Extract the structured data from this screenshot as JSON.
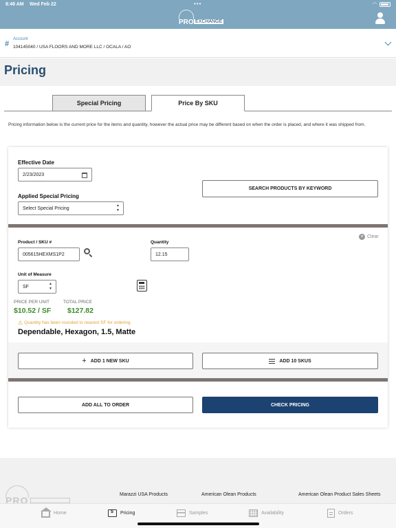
{
  "status_bar": {
    "time": "8:48 AM",
    "date": "Wed Feb 22",
    "dots": "•••"
  },
  "header": {
    "logo_pro": "PRO",
    "logo_exchange": "EXCHANGE"
  },
  "account": {
    "label": "Account",
    "value": "104145040 / USA FLOORS AND MORE LLC / OCALA / AO"
  },
  "page": {
    "title": "Pricing"
  },
  "tabs": [
    {
      "label": "Special Pricing",
      "active": false
    },
    {
      "label": "Price By SKU",
      "active": true
    }
  ],
  "info_text": "Pricing information below is the current price for the items and quantity, however the actual price may be different based on when the order is placed, and where it was shipped from.",
  "form": {
    "effective_date_label": "Effective Date",
    "effective_date_value": "2/23/2023",
    "special_pricing_label": "Applied Special Pricing",
    "special_pricing_value": "Select Special Pricing",
    "search_keyword_button": "SEARCH PRODUCTS BY KEYWORD"
  },
  "sku_entry": {
    "clear_label": "Clear",
    "product_label": "Product / SKU #",
    "product_value": "005615HEXMS1P2",
    "quantity_label": "Quantity",
    "quantity_value": "12.15",
    "uom_label": "Unit of Measure",
    "uom_value": "SF",
    "price_per_unit_label": "PRICE PER UNIT",
    "price_per_unit_value": "$10.52 / SF",
    "total_price_label": "TOTAL PRICE",
    "total_price_value": "$127.82",
    "warning": "Quantity has been rounded to nearest SF for ordering.",
    "product_name": "Dependable, Hexagon, 1.5, Matte"
  },
  "actions": {
    "add_new_sku": "ADD 1 NEW SKU",
    "add_ten_skus": "ADD 10 SKUS",
    "add_all_to_order": "ADD ALL TO ORDER",
    "check_pricing": "CHECK PRICING"
  },
  "footer": {
    "links": [
      "Marazzi USA Products",
      "American Olean Products",
      "American Olean Product Sales Sheets"
    ]
  },
  "tabbar": [
    {
      "label": "Home",
      "icon": "home-icon"
    },
    {
      "label": "Pricing",
      "icon": "pricing-icon",
      "active": true
    },
    {
      "label": "Samples",
      "icon": "samples-icon"
    },
    {
      "label": "Availability",
      "icon": "availability-icon"
    },
    {
      "label": "Orders",
      "icon": "orders-icon"
    }
  ],
  "colors": {
    "header": "#7fa7bf",
    "primary": "#1b4270",
    "price": "#3a8a2a",
    "warning": "#e0a233",
    "title": "#2a4d6f"
  }
}
